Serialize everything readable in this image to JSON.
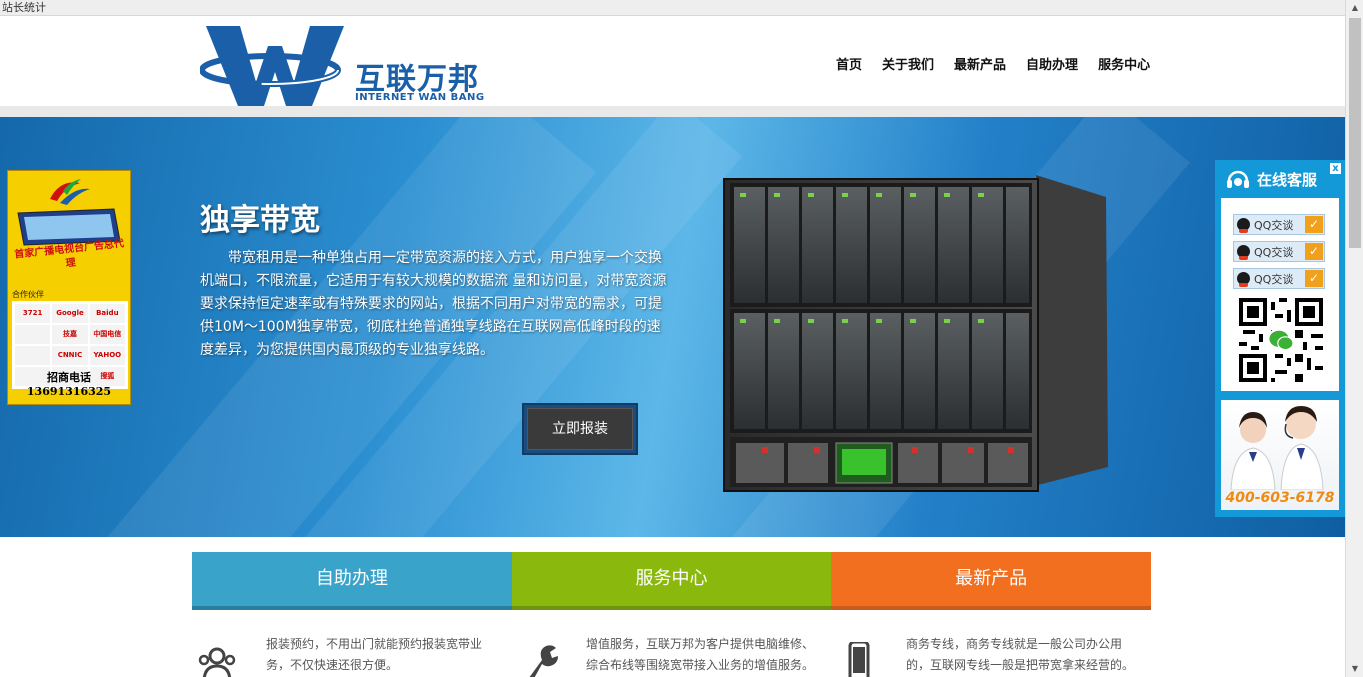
{
  "browser_tab": {
    "title": "站长统计"
  },
  "header": {
    "logo_cn": "互联万邦",
    "logo_en": "INTERNET WAN BANG",
    "nav": [
      "首页",
      "关于我们",
      "最新产品",
      "自助办理",
      "服务中心"
    ]
  },
  "banner": {
    "title": "独享带宽",
    "description": "带宽租用是一种单独占用一定带宽资源的接入方式，用户独享一个交换机端口，不限流量，它适用于有较大规模的数据流 量和访问量，对带宽资源要求保持恒定速率或有特殊要求的网站，根据不同用户对带宽的需求，可提供10M～100M独享带宽，彻底杜绝普通独享线路在互联网高低峰时段的速度差异，为您提供国内最顶级的专业独享线路。",
    "button": "立即报装"
  },
  "ad_left": {
    "title": "首家广播电视台广告总代理",
    "partners_label": "合作伙伴",
    "partners": [
      "3721",
      "Google",
      "Baidu",
      "",
      "技嘉",
      "中国电信",
      "",
      "CNNIC",
      "YAHOO",
      "",
      "",
      "搜狐"
    ],
    "phone": "招商电话13691316325"
  },
  "kefu": {
    "title": "在线客服",
    "close": "x",
    "qq_buttons": [
      "QQ交谈",
      "QQ交谈",
      "QQ交谈"
    ],
    "check": "✓",
    "phone": "400-603-6178"
  },
  "tabs": [
    "自助办理",
    "服务中心",
    "最新产品"
  ],
  "features": [
    {
      "icon": "user-group-icon",
      "text": "报装预约，不用出门就能预约报装宽带业务，不仅快速还很方便。"
    },
    {
      "icon": "wrench-icon",
      "text": "增值服务，互联万邦为客户提供电脑维修、综合布线等围绕宽带接入业务的增值服务。"
    },
    {
      "icon": "phone-device-icon",
      "text": "商务专线，商务专线就是一般公司办公用的，互联网专线一般是把带宽拿来经营的。"
    }
  ],
  "colors": {
    "brand_blue": "#1a5fa8",
    "tab1": "#3aa3c9",
    "tab2": "#8ab80c",
    "tab3": "#f26f20",
    "kefu_blue": "#1398d8"
  }
}
